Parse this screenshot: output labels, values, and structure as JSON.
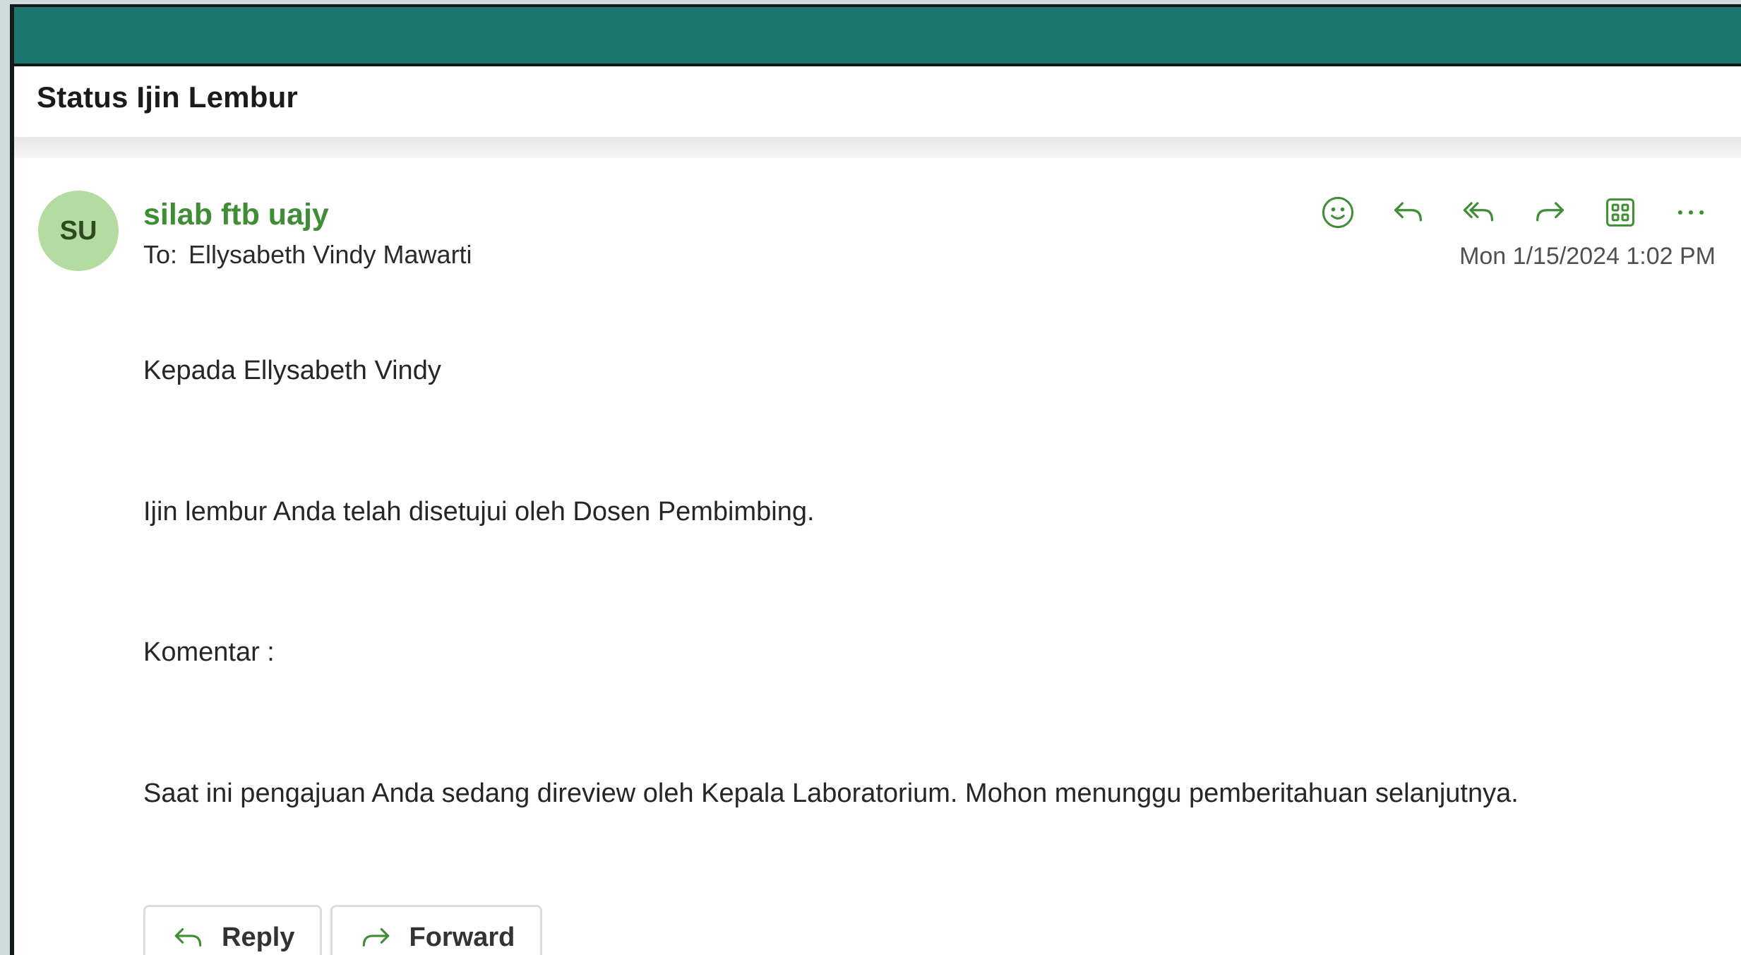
{
  "window": {
    "subject": "Status Ijin Lembur"
  },
  "sender": {
    "initials": "SU",
    "name": "silab ftb uajy",
    "to_label": "To:",
    "to_name": "Ellysabeth Vindy Mawarti",
    "timestamp": "Mon 1/15/2024 1:02 PM"
  },
  "actions": [
    {
      "icon": "smiley-icon",
      "label": "React"
    },
    {
      "icon": "reply-icon",
      "label": "Reply"
    },
    {
      "icon": "reply-all-icon",
      "label": "Reply all"
    },
    {
      "icon": "forward-icon",
      "label": "Forward"
    },
    {
      "icon": "apps-grid-icon",
      "label": "Apps"
    },
    {
      "icon": "more-icon",
      "label": "More actions"
    }
  ],
  "body": {
    "greeting": "Kepada Ellysabeth Vindy",
    "line_approved": "Ijin lembur Anda telah disetujui oleh Dosen Pembimbing.",
    "line_comment": "Komentar :",
    "line_status": "Saat ini pengajuan Anda sedang direview oleh Kepala Laboratorium. Mohon menunggu pemberitahuan selanjutnya."
  },
  "footer": {
    "reply_label": "Reply",
    "forward_label": "Forward"
  },
  "colors": {
    "topbar": "#1c786e",
    "sender_name": "#3f8e36",
    "avatar_bg": "#b5dca0",
    "icon": "#3f8e36"
  }
}
